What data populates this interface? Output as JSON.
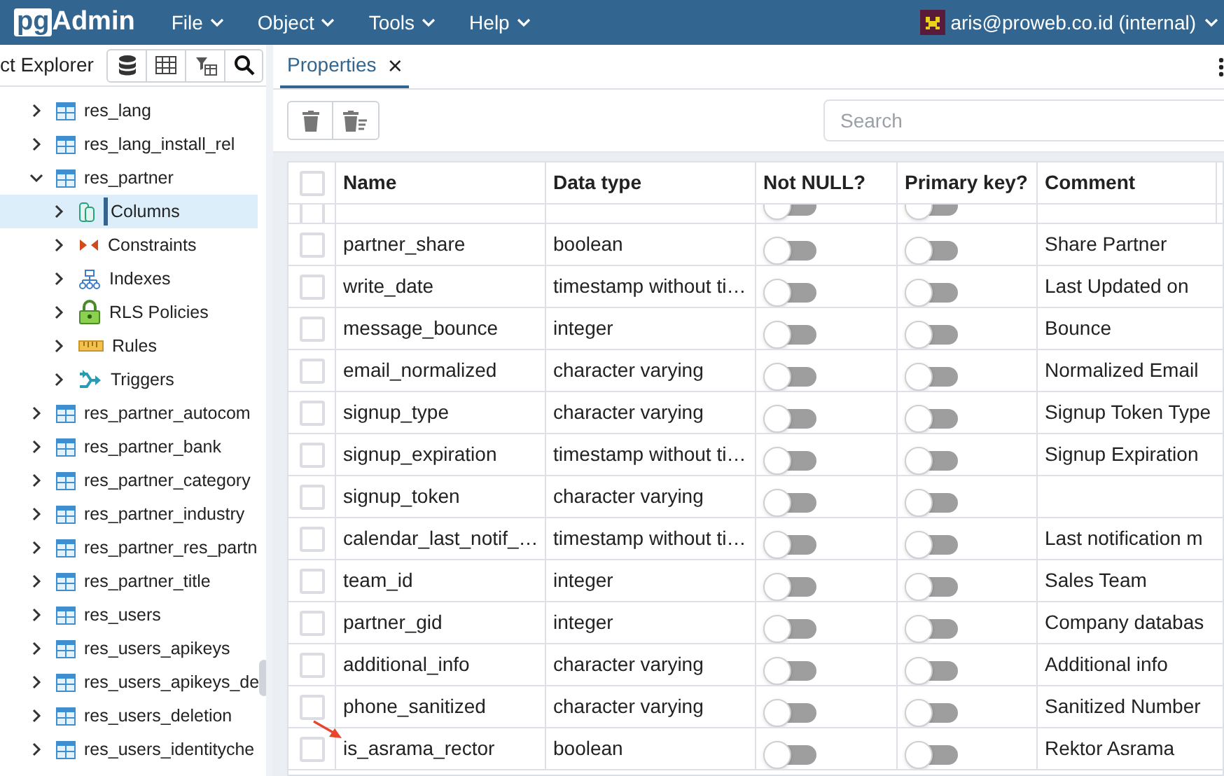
{
  "app": {
    "logo_left": "pg",
    "logo_right": "Admin"
  },
  "menu": [
    {
      "label": "File"
    },
    {
      "label": "Object"
    },
    {
      "label": "Tools"
    },
    {
      "label": "Help"
    }
  ],
  "user": "aris@proweb.co.id (internal)",
  "explorer": {
    "title": "ct Explorer",
    "tree": [
      {
        "label": "res_lang",
        "kind": "table",
        "expanded": false,
        "selected": false
      },
      {
        "label": "res_lang_install_rel",
        "kind": "table",
        "expanded": false,
        "selected": false
      },
      {
        "label": "res_partner",
        "kind": "table",
        "expanded": true,
        "selected": false,
        "children": [
          {
            "label": "Columns",
            "kind": "columns",
            "expanded": false,
            "selected": true
          },
          {
            "label": "Constraints",
            "kind": "constraints",
            "expanded": false,
            "selected": false
          },
          {
            "label": "Indexes",
            "kind": "indexes",
            "expanded": false,
            "selected": false
          },
          {
            "label": "RLS Policies",
            "kind": "policies",
            "expanded": false,
            "selected": false
          },
          {
            "label": "Rules",
            "kind": "rules",
            "expanded": false,
            "selected": false
          },
          {
            "label": "Triggers",
            "kind": "triggers",
            "expanded": false,
            "selected": false
          }
        ]
      },
      {
        "label": "res_partner_autocom",
        "kind": "table",
        "expanded": false,
        "selected": false
      },
      {
        "label": "res_partner_bank",
        "kind": "table",
        "expanded": false,
        "selected": false
      },
      {
        "label": "res_partner_category",
        "kind": "table",
        "expanded": false,
        "selected": false
      },
      {
        "label": "res_partner_industry",
        "kind": "table",
        "expanded": false,
        "selected": false
      },
      {
        "label": "res_partner_res_partn",
        "kind": "table",
        "expanded": false,
        "selected": false
      },
      {
        "label": "res_partner_title",
        "kind": "table",
        "expanded": false,
        "selected": false
      },
      {
        "label": "res_users",
        "kind": "table",
        "expanded": false,
        "selected": false
      },
      {
        "label": "res_users_apikeys",
        "kind": "table",
        "expanded": false,
        "selected": false
      },
      {
        "label": "res_users_apikeys_de",
        "kind": "table",
        "expanded": false,
        "selected": false
      },
      {
        "label": "res_users_deletion",
        "kind": "table",
        "expanded": false,
        "selected": false
      },
      {
        "label": "res_users_identityche",
        "kind": "table",
        "expanded": false,
        "selected": false
      }
    ]
  },
  "tabs": [
    {
      "label": "Properties",
      "selected": true,
      "close": "×"
    }
  ],
  "search": {
    "placeholder": "Search"
  },
  "table": {
    "columns": [
      "Name",
      "Data type",
      "Not NULL?",
      "Primary key?",
      "Comment"
    ],
    "partial_row": {
      "checked": false,
      "not_null": false,
      "primary_key": false
    },
    "rows": [
      {
        "name": "partner_share",
        "type": "boolean",
        "not_null": false,
        "primary_key": false,
        "comment": "Share Partner",
        "checked": false,
        "arrow": false
      },
      {
        "name": "write_date",
        "type": "timestamp without ti…",
        "not_null": false,
        "primary_key": false,
        "comment": "Last Updated on",
        "checked": false,
        "arrow": false
      },
      {
        "name": "message_bounce",
        "type": "integer",
        "not_null": false,
        "primary_key": false,
        "comment": "Bounce",
        "checked": false,
        "arrow": false
      },
      {
        "name": "email_normalized",
        "type": "character varying",
        "not_null": false,
        "primary_key": false,
        "comment": "Normalized Email",
        "checked": false,
        "arrow": false
      },
      {
        "name": "signup_type",
        "type": "character varying",
        "not_null": false,
        "primary_key": false,
        "comment": "Signup Token Type",
        "checked": false,
        "arrow": false
      },
      {
        "name": "signup_expiration",
        "type": "timestamp without ti…",
        "not_null": false,
        "primary_key": false,
        "comment": "Signup Expiration",
        "checked": false,
        "arrow": false
      },
      {
        "name": "signup_token",
        "type": "character varying",
        "not_null": false,
        "primary_key": false,
        "checked": false,
        "arrow": false
      },
      {
        "name": "calendar_last_notif_…",
        "type": "timestamp without ti…",
        "not_null": false,
        "primary_key": false,
        "comment": "Last notification m",
        "checked": false,
        "arrow": false
      },
      {
        "name": "team_id",
        "type": "integer",
        "not_null": false,
        "primary_key": false,
        "comment": "Sales Team",
        "checked": false,
        "arrow": false
      },
      {
        "name": "partner_gid",
        "type": "integer",
        "not_null": false,
        "primary_key": false,
        "comment": "Company databas",
        "checked": false,
        "arrow": false
      },
      {
        "name": "additional_info",
        "type": "character varying",
        "not_null": false,
        "primary_key": false,
        "comment": "Additional info",
        "checked": false,
        "arrow": false
      },
      {
        "name": "phone_sanitized",
        "type": "character varying",
        "not_null": false,
        "primary_key": false,
        "comment": "Sanitized Number",
        "checked": false,
        "arrow": false
      },
      {
        "name": "is_asrama_rector",
        "type": "boolean",
        "not_null": false,
        "primary_key": false,
        "comment": "Rektor Asrama",
        "checked": false,
        "arrow": true
      }
    ]
  }
}
